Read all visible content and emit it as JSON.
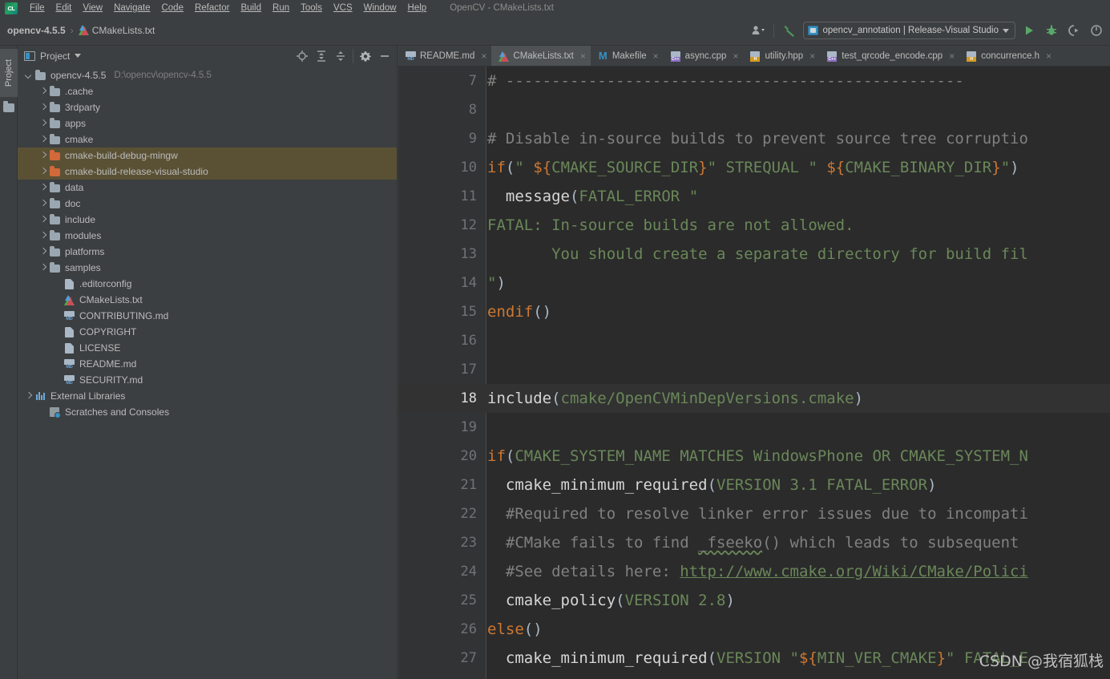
{
  "window": {
    "title": "OpenCV - CMakeLists.txt"
  },
  "menubar": {
    "logo": "cl-logo-icon",
    "items": [
      {
        "label": "File"
      },
      {
        "label": "Edit"
      },
      {
        "label": "View"
      },
      {
        "label": "Navigate"
      },
      {
        "label": "Code"
      },
      {
        "label": "Refactor"
      },
      {
        "label": "Build"
      },
      {
        "label": "Run"
      },
      {
        "label": "Tools"
      },
      {
        "label": "VCS"
      },
      {
        "label": "Window"
      },
      {
        "label": "Help"
      }
    ]
  },
  "navbar": {
    "breadcrumb": [
      {
        "label": "opencv-4.5.5",
        "icon": ""
      },
      {
        "label": "CMakeLists.txt",
        "icon": "cmake-icon"
      }
    ],
    "separator": "›",
    "run_config": "opencv_annotation | Release-Visual Studio",
    "right_icons": [
      "user-avatar-icon",
      "build-hammer-icon",
      "run-icon",
      "debug-icon",
      "run-with-coverage-icon",
      "profiler-icon"
    ]
  },
  "left_strip": {
    "tool_label": "Project"
  },
  "project_panel": {
    "title": "Project",
    "header_icons": [
      "locate-target-icon",
      "expand-all-icon",
      "collapse-all-icon",
      "settings-gear-icon",
      "hide-minimize-icon"
    ],
    "tree": [
      {
        "label": "opencv-4.5.5",
        "path": "D:\\opencv\\opencv-4.5.5",
        "icon": "folder-icon",
        "arrow": "down",
        "indent": 0,
        "selected": false
      },
      {
        "label": ".cache",
        "path": "",
        "icon": "folder-icon",
        "arrow": "right",
        "indent": 1,
        "selected": false
      },
      {
        "label": "3rdparty",
        "path": "",
        "icon": "folder-icon",
        "arrow": "right",
        "indent": 1,
        "selected": false
      },
      {
        "label": "apps",
        "path": "",
        "icon": "folder-icon",
        "arrow": "right",
        "indent": 1,
        "selected": false
      },
      {
        "label": "cmake",
        "path": "",
        "icon": "folder-icon",
        "arrow": "right",
        "indent": 1,
        "selected": false
      },
      {
        "label": "cmake-build-debug-mingw",
        "path": "",
        "icon": "folder-orange-icon",
        "arrow": "right",
        "indent": 1,
        "selected": true
      },
      {
        "label": "cmake-build-release-visual-studio",
        "path": "",
        "icon": "folder-orange-icon",
        "arrow": "right",
        "indent": 1,
        "selected": true
      },
      {
        "label": "data",
        "path": "",
        "icon": "folder-icon",
        "arrow": "right",
        "indent": 1,
        "selected": false
      },
      {
        "label": "doc",
        "path": "",
        "icon": "folder-icon",
        "arrow": "right",
        "indent": 1,
        "selected": false
      },
      {
        "label": "include",
        "path": "",
        "icon": "folder-icon",
        "arrow": "right",
        "indent": 1,
        "selected": false
      },
      {
        "label": "modules",
        "path": "",
        "icon": "folder-icon",
        "arrow": "right",
        "indent": 1,
        "selected": false
      },
      {
        "label": "platforms",
        "path": "",
        "icon": "folder-icon",
        "arrow": "right",
        "indent": 1,
        "selected": false
      },
      {
        "label": "samples",
        "path": "",
        "icon": "folder-icon",
        "arrow": "right",
        "indent": 1,
        "selected": false
      },
      {
        "label": ".editorconfig",
        "path": "",
        "icon": "text-file-icon",
        "arrow": "none",
        "indent": 2,
        "selected": false
      },
      {
        "label": "CMakeLists.txt",
        "path": "",
        "icon": "cmake-file-icon",
        "arrow": "none",
        "indent": 2,
        "selected": false
      },
      {
        "label": "CONTRIBUTING.md",
        "path": "",
        "icon": "markdown-file-icon",
        "arrow": "none",
        "indent": 2,
        "selected": false
      },
      {
        "label": "COPYRIGHT",
        "path": "",
        "icon": "text-file-icon",
        "arrow": "none",
        "indent": 2,
        "selected": false
      },
      {
        "label": "LICENSE",
        "path": "",
        "icon": "text-file-icon",
        "arrow": "none",
        "indent": 2,
        "selected": false
      },
      {
        "label": "README.md",
        "path": "",
        "icon": "markdown-file-icon",
        "arrow": "none",
        "indent": 2,
        "selected": false
      },
      {
        "label": "SECURITY.md",
        "path": "",
        "icon": "markdown-file-icon",
        "arrow": "none",
        "indent": 2,
        "selected": false
      },
      {
        "label": "External Libraries",
        "path": "",
        "icon": "library-icon",
        "arrow": "right",
        "indent": 0,
        "selected": false
      },
      {
        "label": "Scratches and Consoles",
        "path": "",
        "icon": "scratches-icon",
        "arrow": "none",
        "indent": 1,
        "selected": false
      }
    ]
  },
  "editor_tabs": [
    {
      "label": "README.md",
      "icon": "markdown-file-icon",
      "active": false,
      "close": "×"
    },
    {
      "label": "CMakeLists.txt",
      "icon": "cmake-file-icon",
      "active": true,
      "close": "×"
    },
    {
      "label": "Makefile",
      "icon": "makefile-icon",
      "active": false,
      "close": "×"
    },
    {
      "label": "async.cpp",
      "icon": "cpp-file-icon",
      "active": false,
      "close": "×"
    },
    {
      "label": "utility.hpp",
      "icon": "header-file-icon",
      "active": false,
      "close": "×"
    },
    {
      "label": "test_qrcode_encode.cpp",
      "icon": "cpp-file-icon",
      "active": false,
      "close": "×"
    },
    {
      "label": "concurrence.h",
      "icon": "header-file-icon",
      "active": false,
      "close": "×"
    }
  ],
  "editor": {
    "current_line": 18,
    "lines": [
      {
        "n": 7,
        "html": "<span class=\"cm\"># --------------------------------------------------</span>"
      },
      {
        "n": 8,
        "html": ""
      },
      {
        "n": 9,
        "html": "<span class=\"cm\"># Disable in-source builds to prevent source tree corruptio</span>"
      },
      {
        "n": 10,
        "html": "<span class=\"kw\">if</span><span class=\"pn\">(</span><span class=\"st\">\" </span><span class=\"var\">${</span><span class=\"ar\">CMAKE_SOURCE_DIR</span><span class=\"var\">}</span><span class=\"st\">\" STREQUAL \" </span><span class=\"var\">${</span><span class=\"ar\">CMAKE_BINARY_DIR</span><span class=\"var\">}</span><span class=\"st\">\"</span><span class=\"pn\">)</span>"
      },
      {
        "n": 11,
        "html": "  <span class=\"fn\">message</span><span class=\"pn\">(</span><span class=\"ar\">FATAL_ERROR</span><span class=\"st\"> \"</span>"
      },
      {
        "n": 12,
        "html": "<span class=\"st\">FATAL: In-source builds are not allowed.</span>"
      },
      {
        "n": 13,
        "html": "<span class=\"st\">       You should create a separate directory for build fil</span>"
      },
      {
        "n": 14,
        "html": "<span class=\"st\">\"</span><span class=\"pn\">)</span>"
      },
      {
        "n": 15,
        "html": "<span class=\"kw\">endif</span><span class=\"pn\">()</span>"
      },
      {
        "n": 16,
        "html": ""
      },
      {
        "n": 17,
        "html": ""
      },
      {
        "n": 18,
        "html": "<span class=\"fn\">include</span><span class=\"pn\">(</span><span class=\"ar\">cmake/OpenCVMinDepVersions.cmake</span><span class=\"pn\">)</span>"
      },
      {
        "n": 19,
        "html": ""
      },
      {
        "n": 20,
        "html": "<span class=\"kw\">if</span><span class=\"pn\">(</span><span class=\"ar\">CMAKE_SYSTEM_NAME MATCHES WindowsPhone OR CMAKE_SYSTEM_N</span>"
      },
      {
        "n": 21,
        "html": "  <span class=\"fn\">cmake_minimum_required</span><span class=\"pn\">(</span><span class=\"ar\">VERSION 3.1 FATAL_ERROR</span><span class=\"pn\">)</span>"
      },
      {
        "n": 22,
        "html": "  <span class=\"cm\">#Required to resolve linker error issues due to incompati</span>"
      },
      {
        "n": 23,
        "html": "  <span class=\"cm\">#CMake fails to find <span class=\"typo\">_fseeko</span>() which leads to subsequent</span>"
      },
      {
        "n": 24,
        "html": "  <span class=\"cm\">#See details here: <span class=\"link\">http://www.cmake.org/Wiki/CMake/Polici</span></span>"
      },
      {
        "n": 25,
        "html": "  <span class=\"fn\">cmake_policy</span><span class=\"pn\">(</span><span class=\"ar\">VERSION 2.8</span><span class=\"pn\">)</span>"
      },
      {
        "n": 26,
        "html": "<span class=\"kw\">else</span><span class=\"pn\">()</span>"
      },
      {
        "n": 27,
        "html": "  <span class=\"fn\">cmake_minimum_required</span><span class=\"pn\">(</span><span class=\"ar\">VERSION </span><span class=\"st\">\"</span><span class=\"var\">${</span><span class=\"ar\">MIN_VER_CMAKE</span><span class=\"var\">}</span><span class=\"st\">\"</span><span class=\"ar\"> FATAL_E</span>"
      }
    ]
  },
  "watermark": {
    "text": "CSDN @我宿狐栈"
  },
  "colors": {
    "background": "#3c3f41",
    "editor_background": "#2b2b2b",
    "gutter": "#313335",
    "selection": "#5a5135",
    "accent_orange": "#cc7832",
    "accent_green": "#6a8759",
    "accent_blue": "#3592c4",
    "text": "#bbbbbb",
    "run_green": "#499c54"
  }
}
